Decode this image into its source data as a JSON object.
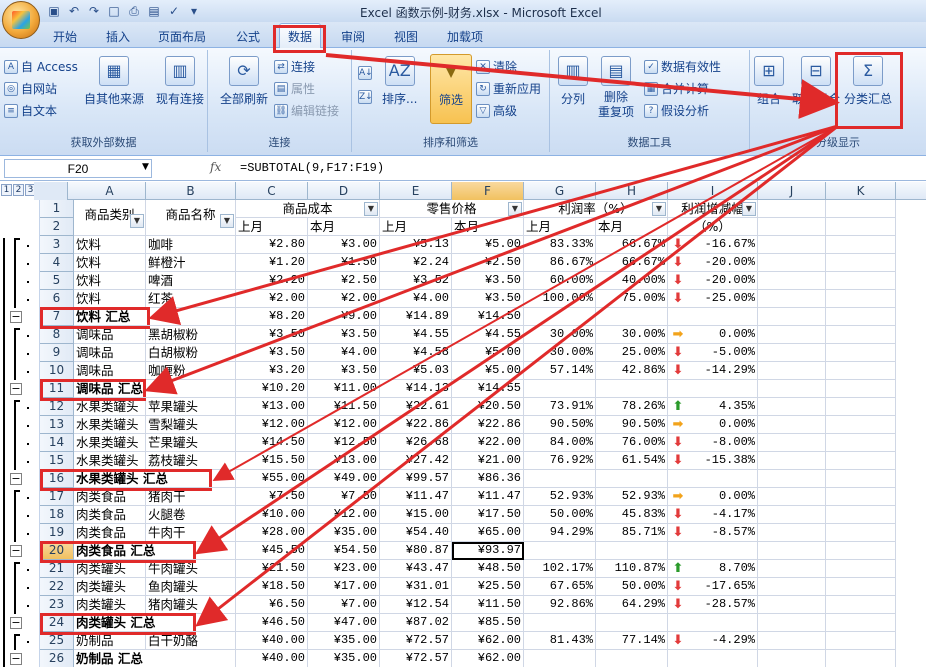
{
  "window": {
    "title": "Excel 函数示例-财务.xlsx - Microsoft Excel"
  },
  "ribbon_tabs": [
    "开始",
    "插入",
    "页面布局",
    "公式",
    "数据",
    "审阅",
    "视图",
    "加载项"
  ],
  "active_tab": "数据",
  "ribbon": {
    "external_data": {
      "label": "获取外部数据",
      "from_access": "自 Access",
      "from_web": "自网站",
      "from_text": "自文本",
      "from_other": "自其他来源",
      "existing": "现有连接"
    },
    "connections": {
      "label": "连接",
      "refresh_all": "全部刷新",
      "connections": "连接",
      "properties": "属性",
      "edit_links": "编辑链接"
    },
    "sort_filter": {
      "label": "排序和筛选",
      "sort": "排序...",
      "filter": "筛选",
      "clear": "清除",
      "reapply": "重新应用",
      "advanced": "高级"
    },
    "data_tools": {
      "label": "数据工具",
      "text_to_columns": "分列",
      "remove_duplicates": "删除\n重复项",
      "validation": "数据有效性",
      "consolidate": "合并计算",
      "what_if": "假设分析"
    },
    "outline": {
      "label": "分级显示",
      "group": "组合",
      "ungroup": "取消组合",
      "subtotal": "分类汇总"
    }
  },
  "formula_bar": {
    "name_box": "F20",
    "fx": "fx",
    "formula": "=SUBTOTAL(9,F17:F19)"
  },
  "outline_levels": [
    "1",
    "2",
    "3"
  ],
  "columns": [
    "A",
    "B",
    "C",
    "D",
    "E",
    "F",
    "G",
    "H",
    "I",
    "J",
    "K"
  ],
  "header_row1": {
    "a": "商品类别",
    "b": "商品名称",
    "cost": "商品成本",
    "retail": "零售价格",
    "margin": "利润率（%）",
    "change": "利润增减幅"
  },
  "header_row2": {
    "c": "上月",
    "d": "本月",
    "e": "上月",
    "f": "本月",
    "g": "上月",
    "h": "本月",
    "i": "（%）"
  },
  "rows": [
    {
      "n": "3",
      "a": "饮料",
      "b": "咖啡",
      "c": "¥2.80",
      "d": "¥3.00",
      "e": "¥5.13",
      "f": "¥5.00",
      "g": "83.33%",
      "h": "66.67%",
      "arrow": "down",
      "i": "-16.67%"
    },
    {
      "n": "4",
      "a": "饮料",
      "b": "鲜橙汁",
      "c": "¥1.20",
      "d": "¥1.50",
      "e": "¥2.24",
      "f": "¥2.50",
      "g": "86.67%",
      "h": "66.67%",
      "arrow": "down",
      "i": "-20.00%"
    },
    {
      "n": "5",
      "a": "饮料",
      "b": "啤酒",
      "c": "¥2.20",
      "d": "¥2.50",
      "e": "¥3.52",
      "f": "¥3.50",
      "g": "60.00%",
      "h": "40.00%",
      "arrow": "down",
      "i": "-20.00%"
    },
    {
      "n": "6",
      "a": "饮料",
      "b": "红茶",
      "c": "¥2.00",
      "d": "¥2.00",
      "e": "¥4.00",
      "f": "¥3.50",
      "g": "100.00%",
      "h": "75.00%",
      "arrow": "down",
      "i": "-25.00%"
    },
    {
      "n": "7",
      "a": "饮料 汇总",
      "b": "",
      "c": "¥8.20",
      "d": "¥9.00",
      "e": "¥14.89",
      "f": "¥14.50",
      "g": "",
      "h": "",
      "arrow": "",
      "i": "",
      "total": true
    },
    {
      "n": "8",
      "a": "调味品",
      "b": "黑胡椒粉",
      "c": "¥3.50",
      "d": "¥3.50",
      "e": "¥4.55",
      "f": "¥4.55",
      "g": "30.00%",
      "h": "30.00%",
      "arrow": "right",
      "i": "0.00%"
    },
    {
      "n": "9",
      "a": "调味品",
      "b": "白胡椒粉",
      "c": "¥3.50",
      "d": "¥4.00",
      "e": "¥4.58",
      "f": "¥5.00",
      "g": "30.00%",
      "h": "25.00%",
      "arrow": "down",
      "i": "-5.00%"
    },
    {
      "n": "10",
      "a": "调味品",
      "b": "咖喱粉",
      "c": "¥3.20",
      "d": "¥3.50",
      "e": "¥5.03",
      "f": "¥5.00",
      "g": "57.14%",
      "h": "42.86%",
      "arrow": "down",
      "i": "-14.29%"
    },
    {
      "n": "11",
      "a": "调味品 汇总",
      "b": "",
      "c": "¥10.20",
      "d": "¥11.00",
      "e": "¥14.13",
      "f": "¥14.55",
      "g": "",
      "h": "",
      "arrow": "",
      "i": "",
      "total": true
    },
    {
      "n": "12",
      "a": "水果类罐头",
      "b": "苹果罐头",
      "c": "¥13.00",
      "d": "¥11.50",
      "e": "¥22.61",
      "f": "¥20.50",
      "g": "73.91%",
      "h": "78.26%",
      "arrow": "up",
      "i": "4.35%"
    },
    {
      "n": "13",
      "a": "水果类罐头",
      "b": "雪梨罐头",
      "c": "¥12.00",
      "d": "¥12.00",
      "e": "¥22.86",
      "f": "¥22.86",
      "g": "90.50%",
      "h": "90.50%",
      "arrow": "right",
      "i": "0.00%"
    },
    {
      "n": "14",
      "a": "水果类罐头",
      "b": "芒果罐头",
      "c": "¥14.50",
      "d": "¥12.50",
      "e": "¥26.68",
      "f": "¥22.00",
      "g": "84.00%",
      "h": "76.00%",
      "arrow": "down",
      "i": "-8.00%"
    },
    {
      "n": "15",
      "a": "水果类罐头",
      "b": "荔枝罐头",
      "c": "¥15.50",
      "d": "¥13.00",
      "e": "¥27.42",
      "f": "¥21.00",
      "g": "76.92%",
      "h": "61.54%",
      "arrow": "down",
      "i": "-15.38%"
    },
    {
      "n": "16",
      "a": "水果类罐头 汇总",
      "b": "",
      "c": "¥55.00",
      "d": "¥49.00",
      "e": "¥99.57",
      "f": "¥86.36",
      "g": "",
      "h": "",
      "arrow": "",
      "i": "",
      "total": true
    },
    {
      "n": "17",
      "a": "肉类食品",
      "b": "猪肉干",
      "c": "¥7.50",
      "d": "¥7.50",
      "e": "¥11.47",
      "f": "¥11.47",
      "g": "52.93%",
      "h": "52.93%",
      "arrow": "right",
      "i": "0.00%"
    },
    {
      "n": "18",
      "a": "肉类食品",
      "b": "火腿卷",
      "c": "¥10.00",
      "d": "¥12.00",
      "e": "¥15.00",
      "f": "¥17.50",
      "g": "50.00%",
      "h": "45.83%",
      "arrow": "down",
      "i": "-4.17%"
    },
    {
      "n": "19",
      "a": "肉类食品",
      "b": "牛肉干",
      "c": "¥28.00",
      "d": "¥35.00",
      "e": "¥54.40",
      "f": "¥65.00",
      "g": "94.29%",
      "h": "85.71%",
      "arrow": "down",
      "i": "-8.57%"
    },
    {
      "n": "20",
      "a": "肉类食品 汇总",
      "b": "",
      "c": "¥45.50",
      "d": "¥54.50",
      "e": "¥80.87",
      "f": "¥93.97",
      "g": "",
      "h": "",
      "arrow": "",
      "i": "",
      "total": true
    },
    {
      "n": "21",
      "a": "肉类罐头",
      "b": "牛肉罐头",
      "c": "¥21.50",
      "d": "¥23.00",
      "e": "¥43.47",
      "f": "¥48.50",
      "g": "102.17%",
      "h": "110.87%",
      "arrow": "up",
      "i": "8.70%"
    },
    {
      "n": "22",
      "a": "肉类罐头",
      "b": "鱼肉罐头",
      "c": "¥18.50",
      "d": "¥17.00",
      "e": "¥31.01",
      "f": "¥25.50",
      "g": "67.65%",
      "h": "50.00%",
      "arrow": "down",
      "i": "-17.65%"
    },
    {
      "n": "23",
      "a": "肉类罐头",
      "b": "猪肉罐头",
      "c": "¥6.50",
      "d": "¥7.00",
      "e": "¥12.54",
      "f": "¥11.50",
      "g": "92.86%",
      "h": "64.29%",
      "arrow": "down",
      "i": "-28.57%"
    },
    {
      "n": "24",
      "a": "肉类罐头 汇总",
      "b": "",
      "c": "¥46.50",
      "d": "¥47.00",
      "e": "¥87.02",
      "f": "¥85.50",
      "g": "",
      "h": "",
      "arrow": "",
      "i": "",
      "total": true
    },
    {
      "n": "25",
      "a": "奶制品",
      "b": "白干奶酪",
      "c": "¥40.00",
      "d": "¥35.00",
      "e": "¥72.57",
      "f": "¥62.00",
      "g": "81.43%",
      "h": "77.14%",
      "arrow": "down",
      "i": "-4.29%"
    },
    {
      "n": "26",
      "a": "奶制品 汇总",
      "b": "",
      "c": "¥40.00",
      "d": "¥35.00",
      "e": "¥72.57",
      "f": "¥62.00",
      "g": "",
      "h": "",
      "arrow": "",
      "i": "",
      "total": true
    }
  ],
  "colors": {
    "annotation_red": "#e02a2a",
    "arrow_down": "#e23a3a",
    "arrow_up": "#2a9a2a",
    "arrow_right": "#f2a31b"
  }
}
